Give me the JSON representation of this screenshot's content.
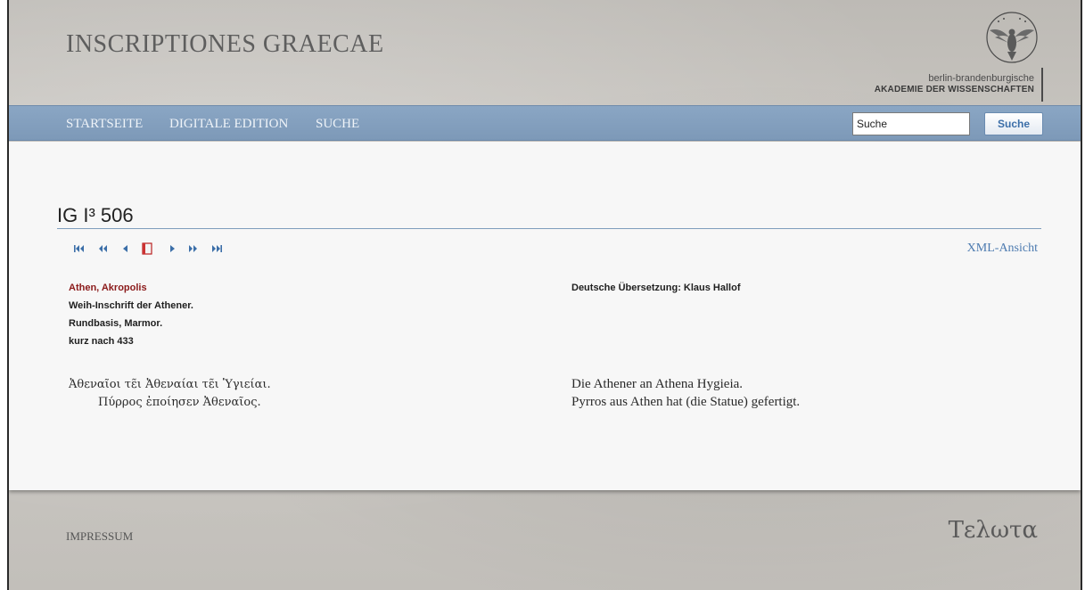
{
  "header": {
    "site_title": "INSCRIPTIONES GRAECAE",
    "logo_line1": "berlin-brandenburgische",
    "logo_line2": "AKADEMIE DER WISSENSCHAFTEN",
    "logo_icon": "eagle-emblem-icon"
  },
  "nav": {
    "items": [
      "STARTSEITE",
      "DIGITALE EDITION",
      "SUCHE"
    ],
    "search_value": "Suche",
    "search_button": "Suche"
  },
  "document": {
    "title": "IG I³ 506",
    "xml_link": "XML-Ansicht",
    "pager_icons": [
      "first-icon",
      "back-far-icon",
      "previous-icon",
      "book-icon",
      "next-icon",
      "forward-far-icon",
      "last-icon"
    ],
    "place": "Athen, Akropolis",
    "type": "Weih-Inschrift der Athener.",
    "object": "Rundbasis, Marmor.",
    "date": "kurz nach 433",
    "translation_heading": "Deutsche Übersetzung: Klaus Hallof",
    "greek_lines": [
      "Ἀθεναῖοι τε̃ι Ἀθεναίαι τε̃ι Ὑγιείαι.",
      "Πύρρος ἐποίησεν Ἀθεναῖος."
    ],
    "german_lines": [
      "Die Athener an Athena Hygieia.",
      "Pyrros aus Athen hat (die Statue) gefertigt."
    ]
  },
  "footer": {
    "impressum": "IMPRESSUM",
    "brand": "Τελωτα"
  },
  "colors": {
    "nav_bg": "#7d99b8",
    "link": "#4d7bb0",
    "place": "#8b1a1a",
    "pager": "#3b6ea8"
  }
}
